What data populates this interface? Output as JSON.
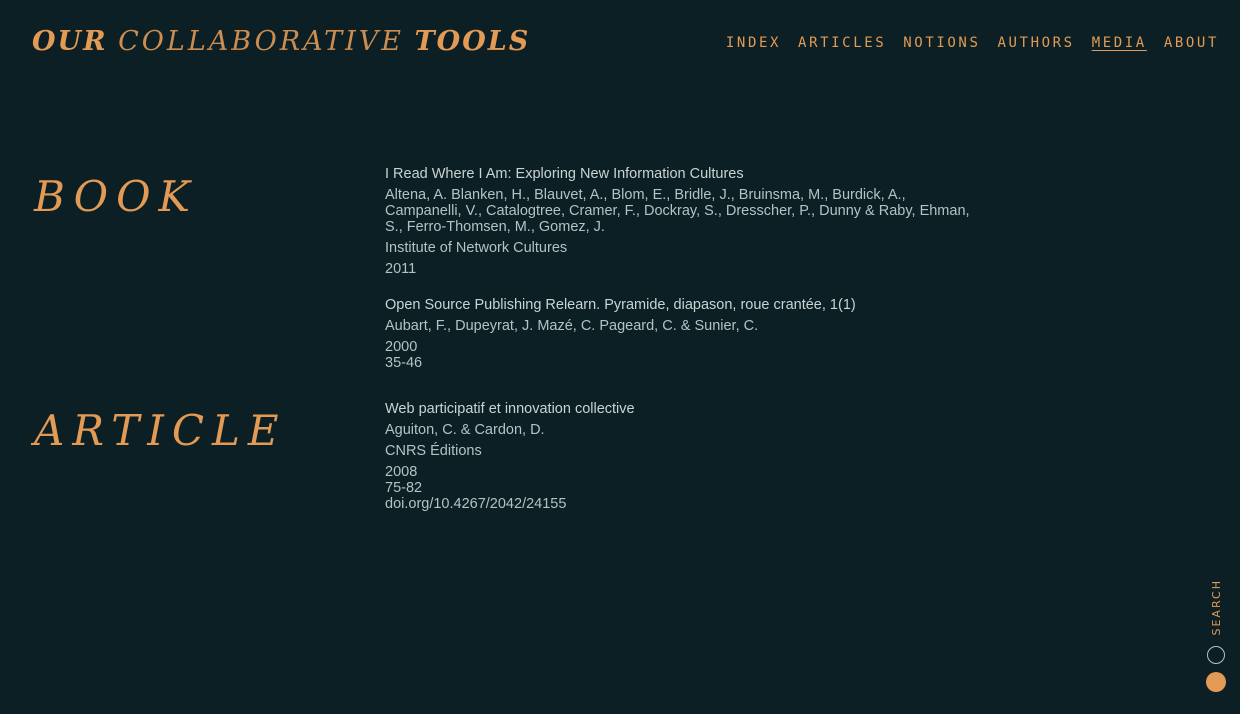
{
  "header": {
    "logo_part1": "OUR",
    "logo_part2": "COLLABORATIVE",
    "logo_part3": "TOOLS"
  },
  "nav": [
    {
      "label": "INDEX",
      "active": false
    },
    {
      "label": "ARTICLES",
      "active": false
    },
    {
      "label": "NOTIONS",
      "active": false
    },
    {
      "label": "AUTHORS",
      "active": false
    },
    {
      "label": "MEDIA",
      "active": true
    },
    {
      "label": "ABOUT",
      "active": false
    }
  ],
  "sections": [
    {
      "heading": "BOOK",
      "entries": [
        {
          "title": "I Read Where I Am: Exploring New Information Cultures",
          "authors": "Altena, A. Blanken, H., Blauvet, A., Blom, E., Bridle, J., Bruinsma, M., Burdick, A., Campanelli, V., Catalogtree, Cramer, F., Dockray, S., Dresscher, P., Dunny & Raby, Ehman, S., Ferro-Thomsen, M., Gomez, J.",
          "publisher": "Institute of Network Cultures",
          "year": "2011",
          "pages": "",
          "doi": ""
        },
        {
          "title": "Open Source Publishing Relearn. Pyramide, diapason, roue crantée, 1(1)",
          "authors": "Aubart, F., Dupeyrat, J. Mazé, C. Pageard, C. & Sunier, C.",
          "publisher": "",
          "year": "2000",
          "pages": "35-46",
          "doi": ""
        }
      ]
    },
    {
      "heading": "ARTICLE",
      "entries": [
        {
          "title": "Web participatif et innovation collective",
          "authors": "Aguiton, C. & Cardon, D.",
          "publisher": "CNRS Éditions",
          "year": "2008",
          "pages": "75-82",
          "doi": "doi.org/10.4267/2042/24155"
        }
      ]
    }
  ],
  "search": {
    "label": "SEARCH"
  },
  "colors": {
    "background": "#0b1f24",
    "accent": "#e39a55",
    "text": "#b3c3c4"
  }
}
